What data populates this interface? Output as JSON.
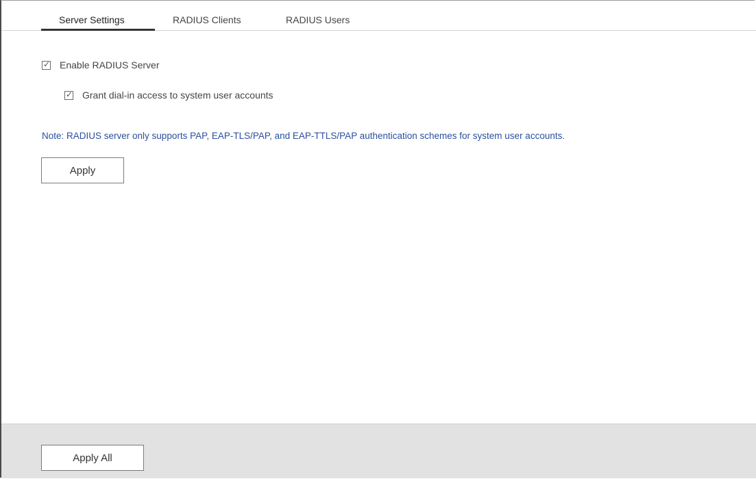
{
  "tabs": [
    {
      "label": "Server Settings",
      "active": true
    },
    {
      "label": "RADIUS Clients",
      "active": false
    },
    {
      "label": "RADIUS Users",
      "active": false
    }
  ],
  "settings": {
    "enable_server": {
      "label": "Enable RADIUS Server",
      "checked": true
    },
    "grant_dialin": {
      "label": "Grant dial-in access to system user accounts",
      "checked": true
    },
    "note": "Note: RADIUS server only supports PAP, EAP-TLS/PAP, and EAP-TTLS/PAP authentication schemes for system user accounts.",
    "apply_label": "Apply"
  },
  "footer": {
    "apply_all_label": "Apply All"
  },
  "colors": {
    "note_text": "#2a4f9e",
    "footer_bg": "#e2e2e2"
  }
}
